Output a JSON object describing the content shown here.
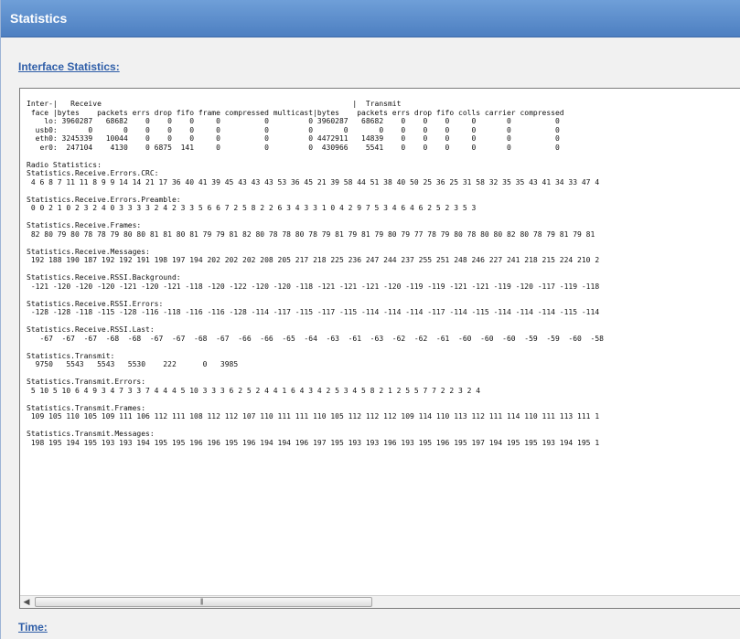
{
  "header": {
    "title": "Statistics"
  },
  "sections": {
    "interface_statistics": "Interface Statistics:",
    "time": "Time:"
  },
  "stats_output": "Inter-|   Receive                                                         |  Transmit\n face |bytes    packets errs drop fifo frame compressed multicast|bytes    packets errs drop fifo colls carrier compressed\n    lo: 3960287   68682    0    0    0     0          0         0 3960287   68682    0    0    0     0       0          0\n  usb0:       0       0    0    0    0     0          0         0       0       0    0    0    0     0       0          0\n  eth0: 3245339   10044    0    0    0     0          0         0 4472911   14839    0    0    0     0       0          0\n   er0:  247104    4130    0 6875  141     0          0         0  430966    5541    0    0    0     0       0          0\n\nRadio Statistics:\nStatistics.Receive.Errors.CRC:\n 4 6 8 7 11 11 8 9 9 14 14 21 17 36 40 41 39 45 43 43 43 53 36 45 21 39 58 44 51 38 40 50 25 36 25 31 58 32 35 35 43 41 34 33 47 4\n\nStatistics.Receive.Errors.Preamble:\n 0 0 2 1 0 2 3 2 4 0 3 3 3 3 2 4 2 3 3 5 6 6 7 2 5 8 2 2 6 3 4 3 3 1 0 4 2 9 7 5 3 4 6 4 6 2 5 2 3 5 3\n\nStatistics.Receive.Frames:\n 82 80 79 80 78 78 79 80 80 81 81 80 81 79 79 81 82 80 78 78 80 78 79 81 79 81 79 80 79 77 78 79 80 78 80 80 82 80 78 79 81 79 81\n\nStatistics.Receive.Messages:\n 192 188 190 187 192 192 191 198 197 194 202 202 202 208 205 217 218 225 236 247 244 237 255 251 248 246 227 241 218 215 224 210 2\n\nStatistics.Receive.RSSI.Background:\n -121 -120 -120 -120 -121 -120 -121 -118 -120 -122 -120 -120 -118 -121 -121 -121 -120 -119 -119 -121 -121 -119 -120 -117 -119 -118\n\nStatistics.Receive.RSSI.Errors:\n -128 -128 -118 -115 -128 -116 -118 -116 -116 -128 -114 -117 -115 -117 -115 -114 -114 -114 -117 -114 -115 -114 -114 -114 -115 -114\n\nStatistics.Receive.RSSI.Last:\n   -67  -67  -67  -68  -68  -67  -67  -68  -67  -66  -66  -65  -64  -63  -61  -63  -62  -62  -61  -60  -60  -60  -59  -59  -60  -58\n\nStatistics.Transmit:\n  9750   5543   5543   5530    222      0   3985\n\nStatistics.Transmit.Errors:\n 5 10 5 10 6 4 9 3 4 7 3 3 7 4 4 4 5 10 3 3 3 6 2 5 2 4 4 1 6 4 3 4 2 5 3 4 5 8 2 1 2 5 5 7 7 2 2 3 2 4\n\nStatistics.Transmit.Frames:\n 109 105 110 105 109 111 106 112 111 108 112 112 107 110 111 111 110 105 112 112 112 109 114 110 113 112 111 114 110 111 113 111 1\n\nStatistics.Transmit.Messages:\n 198 195 194 195 193 193 194 195 195 196 196 195 196 194 194 196 197 195 193 193 196 193 195 196 195 197 194 195 195 193 194 195 1",
  "scrollbar": {
    "left_arrow": "◀",
    "grip": "|||",
    "position_fraction": 0.0
  }
}
